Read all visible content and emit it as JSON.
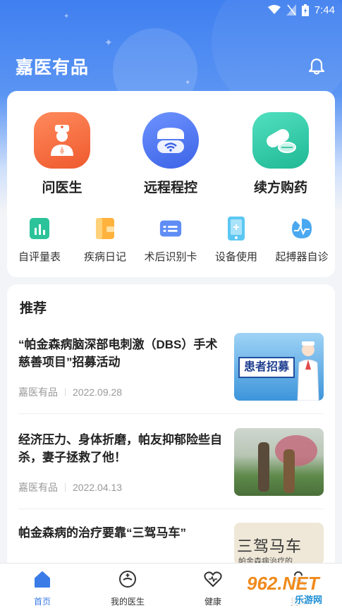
{
  "status_bar": {
    "time": "7:44"
  },
  "header": {
    "title": "嘉医有品"
  },
  "features": [
    {
      "label": "问医生",
      "icon": "doctor-icon"
    },
    {
      "label": "远程程控",
      "icon": "remote-control-icon"
    },
    {
      "label": "续方购药",
      "icon": "pill-icon"
    }
  ],
  "tools": [
    {
      "label": "自评量表",
      "icon": "chart-icon"
    },
    {
      "label": "疾病日记",
      "icon": "diary-icon"
    },
    {
      "label": "术后识别卡",
      "icon": "id-card-icon"
    },
    {
      "label": "设备使用",
      "icon": "device-icon"
    },
    {
      "label": "起搏器自诊",
      "icon": "pacemaker-icon"
    }
  ],
  "recommend": {
    "title": "推荐",
    "articles": [
      {
        "title": "“帕金森病脑深部电刺激（DBS）手术慈善项目”招募活动",
        "source": "嘉医有品",
        "date": "2022.09.28",
        "thumb_text": "患者招募"
      },
      {
        "title": "经济压力、身体折磨，帕友抑郁险些自杀，妻子拯救了他！",
        "source": "嘉医有品",
        "date": "2022.04.13"
      },
      {
        "title": "帕金森病的治疗要靠“三驾马车”",
        "thumb_text": "三驾马车",
        "thumb_subtext": "帕金森病治疗的"
      }
    ]
  },
  "bottom_nav": [
    {
      "label": "首页",
      "icon": "home-icon",
      "active": true
    },
    {
      "label": "我的医生",
      "icon": "doctor-face-icon"
    },
    {
      "label": "健康",
      "icon": "heart-icon"
    },
    {
      "label": "我的",
      "icon": "person-icon"
    }
  ],
  "watermark": {
    "text": "962.NET",
    "subtext": "乐游网"
  },
  "colors": {
    "primary": "#3a7be8",
    "orange": "#f26b3f",
    "blue": "#4f7bf0",
    "teal": "#2fc7a7"
  }
}
